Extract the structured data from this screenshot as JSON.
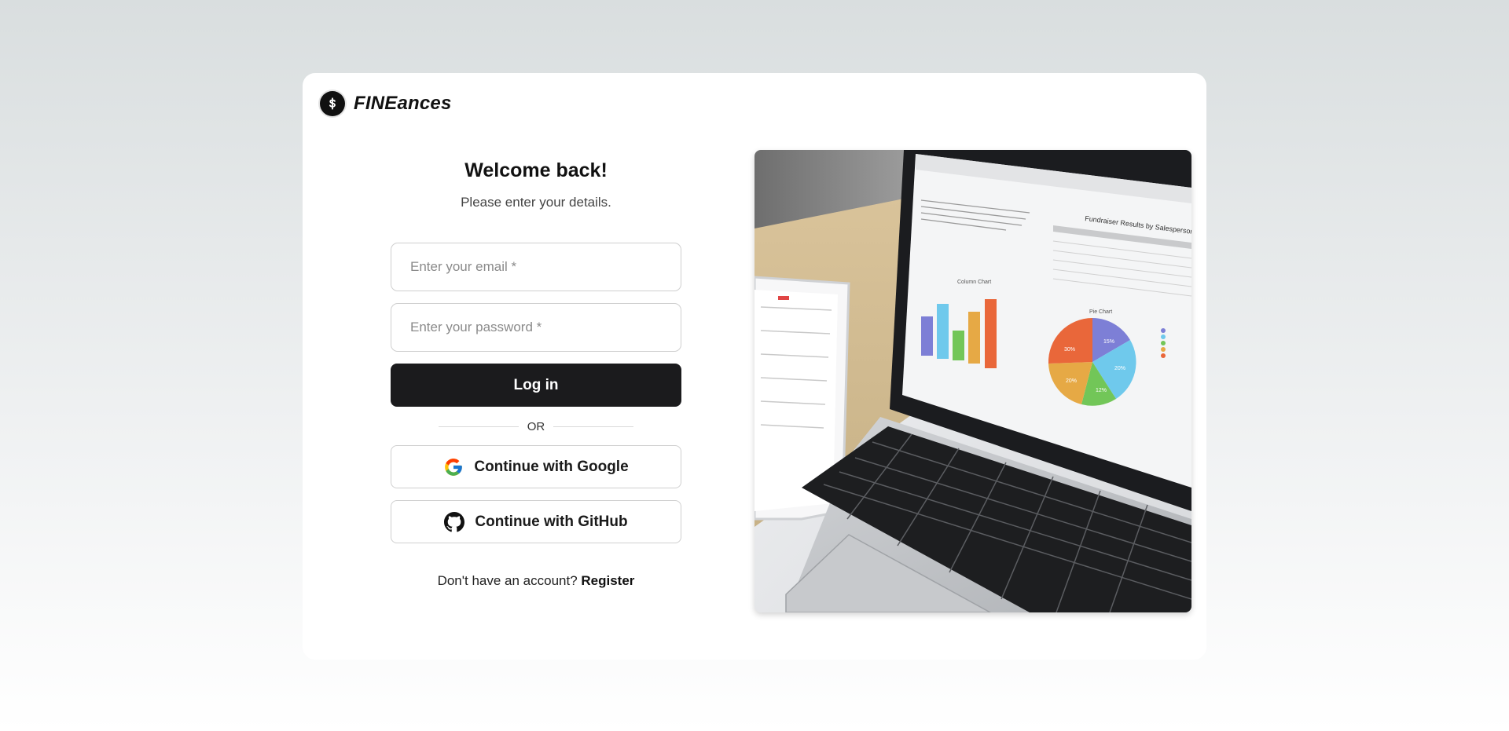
{
  "brand": {
    "name": "FINEances",
    "icon": "dollar-icon"
  },
  "login": {
    "title": "Welcome back!",
    "subtitle": "Please enter your details.",
    "email_placeholder": "Enter your email *",
    "password_placeholder": "Enter your password *",
    "login_label": "Log in",
    "divider_label": "OR",
    "google_label": "Continue with Google",
    "github_label": "Continue with GitHub",
    "register_prompt": "Don't have an account?",
    "register_link": "Register"
  },
  "illustration": {
    "laptop_screen_title": "Fundraiser Results by Salesperson",
    "column_chart_title": "Column Chart",
    "pie_chart_title": "Pie Chart",
    "pie_labels": [
      "15%",
      "20%",
      "12%",
      "20%",
      "30%"
    ]
  },
  "colors": {
    "primary_button": "#1b1b1d",
    "pie_purple": "#7d7fd6",
    "pie_blue": "#6fc9ec",
    "pie_green": "#72c658",
    "pie_yellow": "#e6a945",
    "pie_orange": "#e9673a"
  }
}
